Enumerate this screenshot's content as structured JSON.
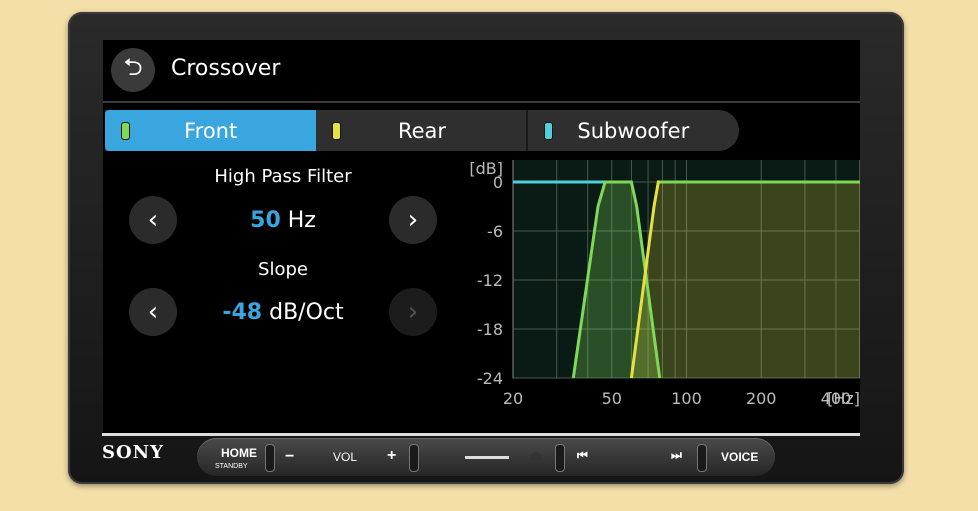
{
  "header": {
    "title": "Crossover"
  },
  "tabs": [
    {
      "label": "Front",
      "color": "#7ed957"
    },
    {
      "label": "Rear",
      "color": "#e8e042"
    },
    {
      "label": "Subwoofer",
      "color": "#4fd0d9"
    }
  ],
  "hpf": {
    "label": "High Pass Filter",
    "value": "50",
    "unit": "Hz"
  },
  "slope": {
    "label": "Slope",
    "value": "-48",
    "unit": "dB/Oct"
  },
  "chart_data": {
    "type": "line",
    "ylabel": "[dB]",
    "xunit": "[Hz]",
    "yticks": [
      "0",
      "-6",
      "-12",
      "-18",
      "-24"
    ],
    "xticks": [
      "20",
      "50",
      "100",
      "200",
      "400"
    ],
    "ylim": [
      -24,
      0
    ],
    "xlim_hz": [
      20,
      500
    ],
    "series": [
      {
        "color": "#4fd0d9",
        "shape": "low-pass",
        "cutoff_hz": 50
      },
      {
        "color": "#7ed957",
        "shape": "band",
        "low_hz": 50,
        "high_hz": 80
      },
      {
        "color": "#e8e042",
        "shape": "high-pass",
        "cutoff_hz": 80
      }
    ]
  },
  "bezel": {
    "brand": "SONY",
    "home": "HOME",
    "standby": "STANDBY",
    "vol_minus": "−",
    "vol": "VOL",
    "vol_plus": "+",
    "prev": "⏮",
    "next": "⏭",
    "voice": "VOICE"
  }
}
